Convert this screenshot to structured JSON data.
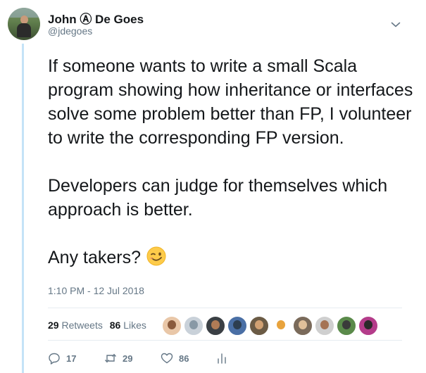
{
  "author": {
    "name": "John Ⓐ De Goes",
    "handle": "@jdegoes"
  },
  "tweet": {
    "paragraphs": [
      "If someone wants to write a small Scala program showing how inheritance or interfaces solve some problem better than FP, I volunteer to write the corresponding FP version.",
      "Developers can judge for themselves which approach is better.",
      "Any takers?"
    ],
    "emoji": "winking-face",
    "timestamp": "1:10 PM - 12 Jul 2018"
  },
  "stats": {
    "retweets_count": "29",
    "retweets_label": "Retweets",
    "likes_count": "86",
    "likes_label": "Likes"
  },
  "likers": [
    {
      "bg": "#e9c7a8",
      "face": "#8a5a3c"
    },
    {
      "bg": "#c9d1d9",
      "face": "#8899a6"
    },
    {
      "bg": "#3a3f44",
      "face": "#b07b56"
    },
    {
      "bg": "#4a6fa5",
      "face": "#2d3e50"
    },
    {
      "bg": "#6b5b45",
      "face": "#d1a173"
    },
    {
      "bg": "#ffffff",
      "face": "#e8a33d"
    },
    {
      "bg": "#7a6a5a",
      "face": "#e0c09a"
    },
    {
      "bg": "#cfcfcf",
      "face": "#a57353"
    },
    {
      "bg": "#5a8a4a",
      "face": "#3a3a3a"
    },
    {
      "bg": "#b43c8a",
      "face": "#2a2a2a"
    }
  ],
  "actions": {
    "replies": "17",
    "retweets": "29",
    "likes": "86"
  },
  "colors": {
    "secondary_text": "#657786",
    "thread_line": "#c4e3f7",
    "divider": "#e6ecf0"
  }
}
